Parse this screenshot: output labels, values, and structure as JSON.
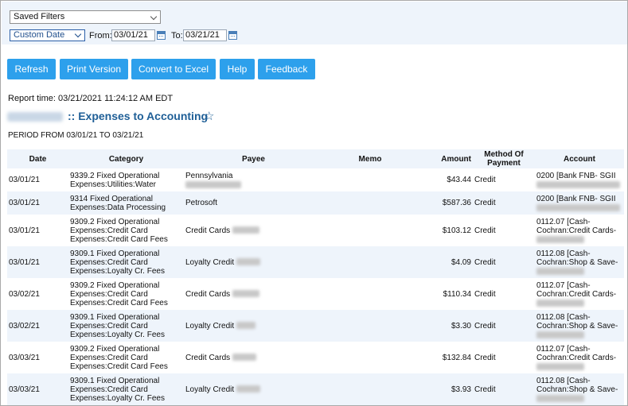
{
  "filters": {
    "saved_filters": "Saved Filters",
    "range": "Custom Date",
    "from_label": "From:",
    "from_value": "03/01/21",
    "to_label": "To:",
    "to_value": "03/21/21"
  },
  "toolbar": {
    "refresh": "Refresh",
    "print": "Print Version",
    "excel": "Convert to Excel",
    "help": "Help",
    "feedback": "Feedback"
  },
  "report": {
    "time": "Report time: 03/21/2021 11:24:12 AM EDT",
    "title": ":: Expenses to Accounting",
    "period": "PERIOD FROM 03/01/21 TO 03/21/21"
  },
  "table": {
    "headers": [
      "Date",
      "Category",
      "Payee",
      "Memo",
      "Amount",
      "Method Of Payment",
      "Account"
    ],
    "rows": [
      {
        "date": "03/01/21",
        "cat1": "9339.2 Fixed Operational",
        "cat2": "Expenses:Utilities:Water",
        "cat3": "",
        "payee": "Pennsylvania",
        "amount": "$43.44",
        "method": "Credit",
        "acct1": "0200 [Bank FNB- SGII",
        "acct2": ""
      },
      {
        "date": "03/01/21",
        "cat1": "9314 Fixed Operational",
        "cat2": "Expenses:Data Processing",
        "cat3": "",
        "payee": "Petrosoft",
        "amount": "$587.36",
        "method": "Credit",
        "acct1": "0200 [Bank FNB- SGII",
        "acct2": ""
      },
      {
        "date": "03/01/21",
        "cat1": "9309.2 Fixed Operational",
        "cat2": "Expenses:Credit Card",
        "cat3": "Expenses:Credit Card Fees",
        "payee": "Credit Cards",
        "amount": "$103.12",
        "method": "Credit",
        "acct1": "0112.07 [Cash-",
        "acct2": "Cochran:Credit Cards-"
      },
      {
        "date": "03/01/21",
        "cat1": "9309.1 Fixed Operational",
        "cat2": "Expenses:Credit Card",
        "cat3": "Expenses:Loyalty Cr. Fees",
        "payee": "Loyalty Credit",
        "amount": "$4.09",
        "method": "Credit",
        "acct1": "0112.08 [Cash-",
        "acct2": "Cochran:Shop & Save-"
      },
      {
        "date": "03/02/21",
        "cat1": "9309.2 Fixed Operational",
        "cat2": "Expenses:Credit Card",
        "cat3": "Expenses:Credit Card Fees",
        "payee": "Credit Cards",
        "amount": "$110.34",
        "method": "Credit",
        "acct1": "0112.07 [Cash-",
        "acct2": "Cochran:Credit Cards-"
      },
      {
        "date": "03/02/21",
        "cat1": "9309.1 Fixed Operational",
        "cat2": "Expenses:Credit Card",
        "cat3": "Expenses:Loyalty Cr. Fees",
        "payee": "Loyalty Credit",
        "amount": "$3.30",
        "method": "Credit",
        "acct1": "0112.08 [Cash-",
        "acct2": "Cochran:Shop & Save-"
      },
      {
        "date": "03/03/21",
        "cat1": "9309.2 Fixed Operational",
        "cat2": "Expenses:Credit Card",
        "cat3": "Expenses:Credit Card Fees",
        "payee": "Credit Cards",
        "amount": "$132.84",
        "method": "Credit",
        "acct1": "0112.07 [Cash-",
        "acct2": "Cochran:Credit Cards-"
      },
      {
        "date": "03/03/21",
        "cat1": "9309.1 Fixed Operational",
        "cat2": "Expenses:Credit Card",
        "cat3": "Expenses:Loyalty Cr. Fees",
        "payee": "Loyalty Credit",
        "amount": "$3.93",
        "method": "Credit",
        "acct1": "0112.08 [Cash-",
        "acct2": "Cochran:Shop & Save-"
      }
    ]
  },
  "icons": {
    "calendar": "calendar-icon",
    "star": "star-outline-icon",
    "dropdown": "chevron-down-icon"
  },
  "colors": {
    "accent": "#2da0ec",
    "title": "#1f5f97",
    "stripe": "#eef4fb"
  }
}
